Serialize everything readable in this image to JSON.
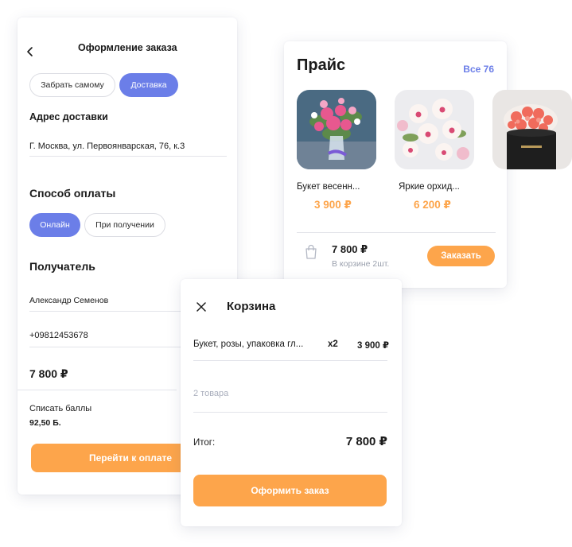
{
  "checkout": {
    "title": "Оформление заказа",
    "delivery_options": [
      {
        "label": "Забрать самому",
        "active": false
      },
      {
        "label": "Доставка",
        "active": true
      }
    ],
    "address_label": "Адрес доставки",
    "address_value": "Г. Москва, ул. Первоянварская, 76, к.3",
    "payment_label": "Способ оплаты",
    "payment_options": [
      {
        "label": "Онлайн",
        "active": true
      },
      {
        "label": "При получении",
        "active": false
      }
    ],
    "recipient_label": "Получатель",
    "recipient_name": "Александр Семенов",
    "recipient_phone": "+09812453678",
    "total": "7 800  ₽",
    "points_label": "Списать баллы",
    "points_value": "92,50 Б.",
    "pay_button": "Перейти к оплате"
  },
  "price": {
    "title": "Прайс",
    "all_link": "Все 76",
    "products": [
      {
        "name": "Букет весенн...",
        "price": "3 900 ₽",
        "image": "pink-roses-bouquet"
      },
      {
        "name": "Яркие орхид...",
        "price": "6 200 ₽",
        "image": "orchids-bouquet"
      },
      {
        "name": "",
        "price": "",
        "image": "coral-roses-box"
      }
    ],
    "cart_total": "7 800 ₽",
    "cart_count": "В корзине 2шт.",
    "order_button": "Заказать",
    "bag_icon": "shopping-bag-icon"
  },
  "cart": {
    "title": "Корзина",
    "item": {
      "name": "Букет, розы, упаковка гл...",
      "qty": "x2",
      "price": "3 900 ₽"
    },
    "goods_count": "2 товара",
    "total_label": "Итог:",
    "total_value": "7 800 ₽",
    "checkout_button": "Оформить заказ"
  },
  "colors": {
    "accent_blue": "#6b7ee8",
    "accent_orange": "#fda54b"
  }
}
